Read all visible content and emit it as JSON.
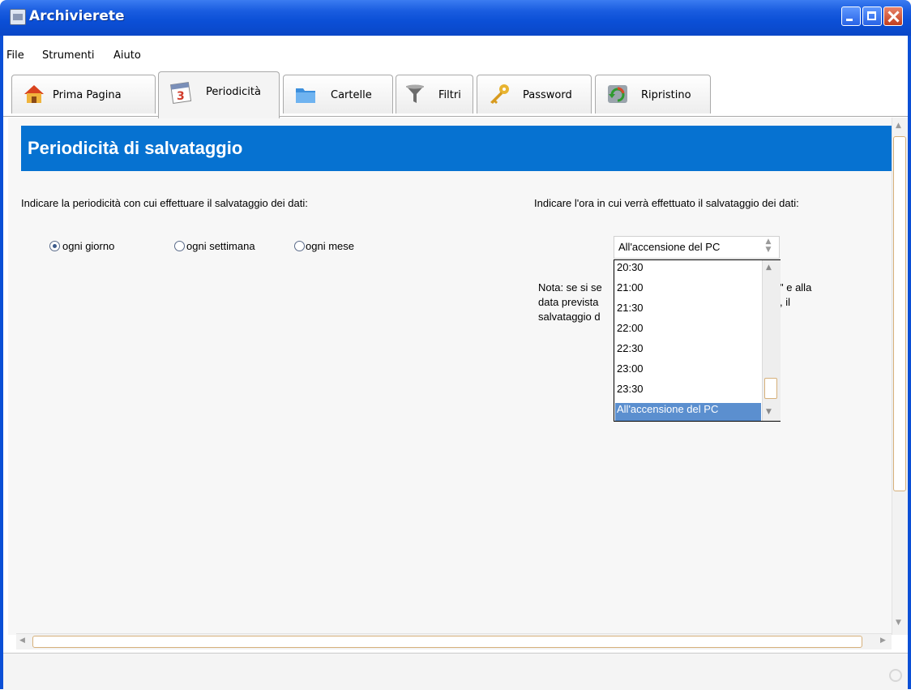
{
  "window": {
    "title": "Archivierete"
  },
  "menu": [
    "File",
    "Strumenti",
    "Aiuto"
  ],
  "tabs": [
    {
      "label": "Prima Pagina",
      "icon": "home-icon"
    },
    {
      "label": "Periodicità",
      "icon": "calendar-icon",
      "active": true
    },
    {
      "label": "Cartelle",
      "icon": "folder-icon"
    },
    {
      "label": "Filtri",
      "icon": "funnel-icon"
    },
    {
      "label": "Password",
      "icon": "key-icon"
    },
    {
      "label": "Ripristino",
      "icon": "restore-icon"
    }
  ],
  "section": {
    "title": "Periodicità di salvataggio"
  },
  "frequency": {
    "label": "Indicare la periodicità con cui effettuare il salvataggio dei dati:",
    "options": [
      "ogni giorno",
      "ogni settimana",
      "ogni mese"
    ],
    "selected": "ogni giorno"
  },
  "time": {
    "label": "Indicare l'ora in cui verrà effettuato il salvataggio dei dati:",
    "selected": "All'accensione del PC",
    "options": [
      "20:30",
      "21:00",
      "21:30",
      "22:00",
      "22:30",
      "23:00",
      "23:30",
      "All'accensione del PC"
    ]
  },
  "note": {
    "line1_a": "Nota: se si se",
    "line1_b": "\" e alla",
    "line2_a": "data prevista",
    "line2_b": ", il",
    "line3_a": "salvataggio d"
  },
  "colors": {
    "header": "#0672d1",
    "titlebar": "#0b4fd6",
    "selection": "#5b8fcf"
  }
}
